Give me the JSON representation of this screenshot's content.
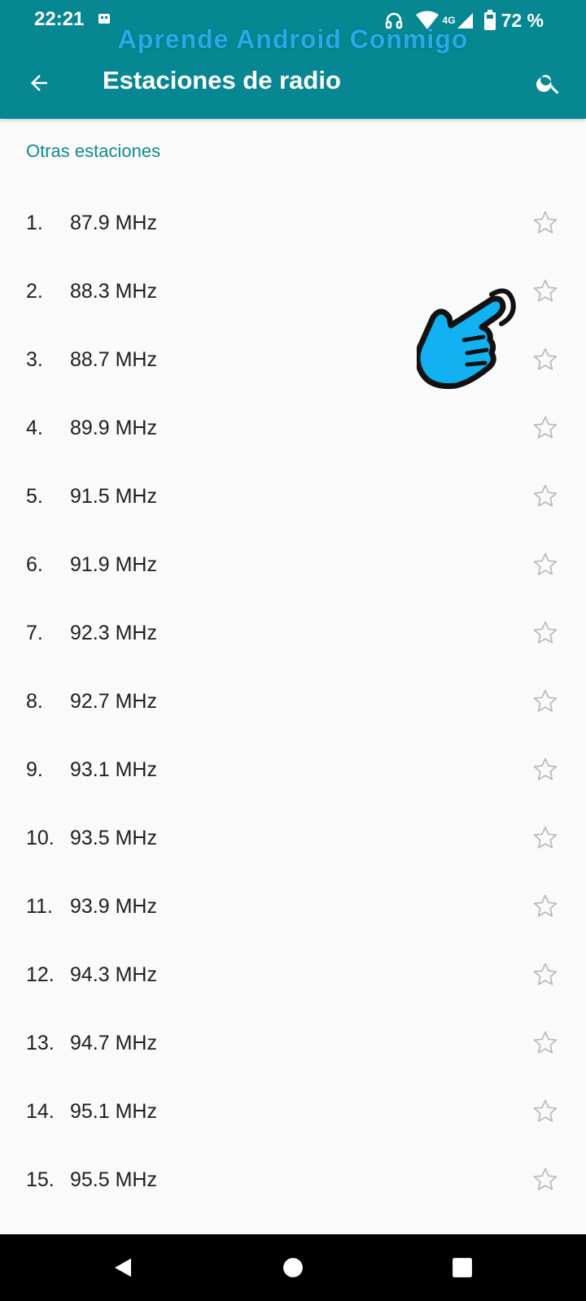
{
  "status_bar": {
    "time": "22:21",
    "network_type": "4G",
    "battery": "72 %",
    "icons": [
      "notification-icon",
      "headphones-icon",
      "wifi-icon",
      "signal-icon",
      "battery-icon"
    ]
  },
  "watermark": "Aprende Android Conmigo",
  "app_bar": {
    "title": "Estaciones de radio",
    "back_icon": "arrow-back-icon",
    "search_icon": "search-icon",
    "color": "#078792"
  },
  "section": {
    "header": "Otras estaciones",
    "color": "#0e8b93"
  },
  "stations": [
    {
      "num": "1.",
      "freq": "87.9 MHz"
    },
    {
      "num": "2.",
      "freq": "88.3 MHz"
    },
    {
      "num": "3.",
      "freq": "88.7 MHz"
    },
    {
      "num": "4.",
      "freq": "89.9 MHz"
    },
    {
      "num": "5.",
      "freq": "91.5 MHz"
    },
    {
      "num": "6.",
      "freq": "91.9 MHz"
    },
    {
      "num": "7.",
      "freq": "92.3 MHz"
    },
    {
      "num": "8.",
      "freq": "92.7 MHz"
    },
    {
      "num": "9.",
      "freq": "93.1 MHz"
    },
    {
      "num": "10.",
      "freq": "93.5 MHz"
    },
    {
      "num": "11.",
      "freq": "93.9 MHz"
    },
    {
      "num": "12.",
      "freq": "94.3 MHz"
    },
    {
      "num": "13.",
      "freq": "94.7 MHz"
    },
    {
      "num": "14.",
      "freq": "95.1 MHz"
    },
    {
      "num": "15.",
      "freq": "95.5 MHz"
    }
  ],
  "favorite_icon": "star-outline-icon",
  "pointer_icon": "pointing-hand-icon",
  "nav_bar": {
    "icons": [
      "back-triangle-icon",
      "home-circle-icon",
      "recents-square-icon"
    ]
  }
}
